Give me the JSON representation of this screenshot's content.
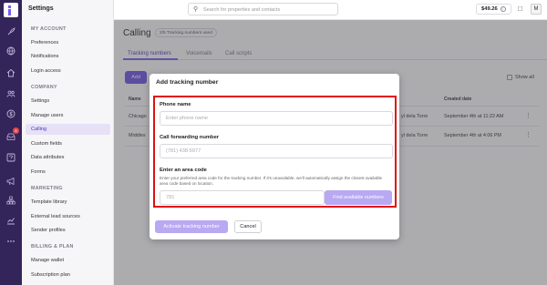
{
  "app": {
    "brand_icon": "brand-logo-icon"
  },
  "rail": {
    "icons": [
      "rocket-icon",
      "globe-icon",
      "home-icon",
      "people-icon",
      "dollar-icon",
      "inbox-icon",
      "help-icon",
      "megaphone-icon",
      "org-chart-icon",
      "analytics-icon",
      "more-icon"
    ],
    "inbox_badge": "5"
  },
  "sidebar": {
    "title": "Settings",
    "sections": [
      {
        "heading": "MY ACCOUNT",
        "items": [
          "Preferences",
          "Notifications",
          "Login access"
        ]
      },
      {
        "heading": "COMPANY",
        "items": [
          "Settings",
          "Manage users",
          "Calling",
          "Custom fields",
          "Data attributes",
          "Forms"
        ]
      },
      {
        "heading": "MARKETING",
        "items": [
          "Template library",
          "External lead sources",
          "Sender profiles"
        ]
      },
      {
        "heading": "BILLING & PLAN",
        "items": [
          "Manage wallet",
          "Subscription plan"
        ]
      }
    ],
    "active_item": "Calling"
  },
  "topbar": {
    "search_placeholder": "Search for properties and contacts",
    "balance": "$49.26",
    "avatar_initial": "M"
  },
  "page": {
    "title": "Calling",
    "usage_badge": "2/5 Tracking numbers used",
    "tabs": [
      "Tracking numbers",
      "Voicemails",
      "Call scripts"
    ],
    "active_tab": "Tracking numbers",
    "add_button": "Add",
    "show_all_label": "Show all",
    "table": {
      "headers": [
        "Name",
        "Created date"
      ],
      "rows": [
        {
          "name": "Chicago",
          "owner": "yl dela Torre",
          "created": "September 4th at 11:22 AM"
        },
        {
          "name": "Middles",
          "owner": "yl dela Torre",
          "created": "September 4th at 4:06 PM"
        }
      ]
    }
  },
  "modal": {
    "title": "Add tracking number",
    "phone_name_label": "Phone name",
    "phone_name_placeholder": "Enter phone name",
    "forwarding_label": "Call forwarding number",
    "forwarding_placeholder": "(781) 438-5977",
    "area_code_label": "Enter an area code",
    "area_code_hint": "Enter your preferred area code for the tracking number. If it's unavailable, we'll automatically assign the closest available area code based on location.",
    "area_code_placeholder": "781",
    "find_button": "Find available numbers",
    "activate_button": "Activate tracking number",
    "cancel_button": "Cancel"
  },
  "colors": {
    "rail_bg": "#33245a",
    "accent": "#6d52e6",
    "accent_disabled": "#b9a8f2",
    "highlight_border": "#e01010"
  }
}
